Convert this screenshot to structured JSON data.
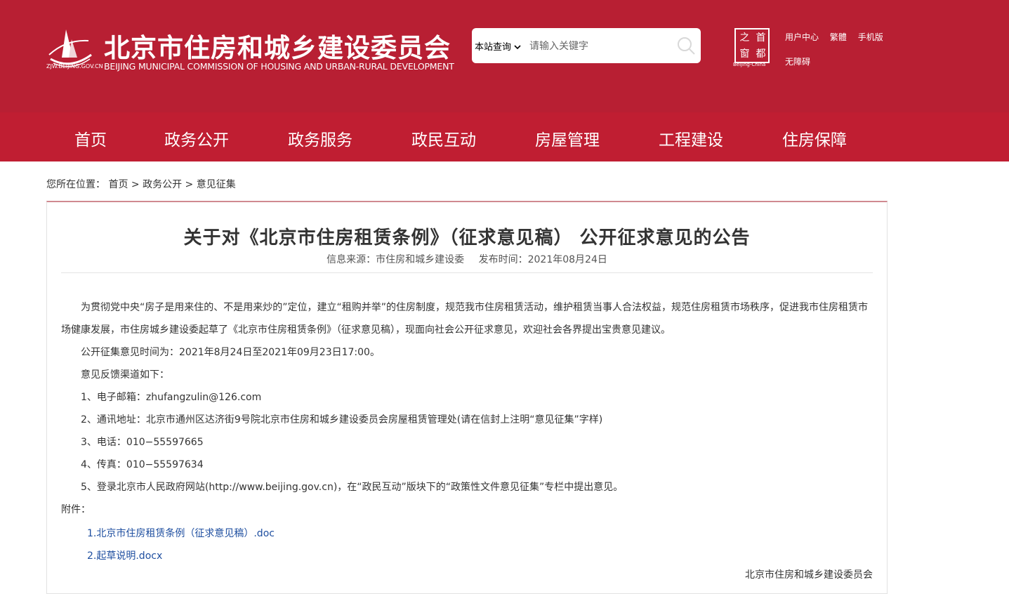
{
  "header": {
    "logo_domain": "ZJW.BEIJING.GOV.CN",
    "title": "北京市住房和城乡建设委员会",
    "subtitle": "BEIJING MUNICIPAL COMMISSION OF HOUSING AND URBAN-RURAL DEVELOPMENT",
    "colors": {
      "header_bg": "#b81f33",
      "nav_bg": "#c01e32"
    }
  },
  "search": {
    "scope_label": "本站查询",
    "placeholder": "请输入关键字",
    "button_icon": "search-icon"
  },
  "capital_logo": {
    "chars": [
      "之",
      "首",
      "窗",
      "都"
    ],
    "caption": "Beijing-China"
  },
  "top_links": {
    "user_center": "用户中心",
    "traditional": "繁體",
    "mobile": "手机版",
    "accessibility": "无障碍"
  },
  "nav": {
    "items": [
      "首页",
      "政务公开",
      "政务服务",
      "政民互动",
      "房屋管理",
      "工程建设",
      "住房保障"
    ]
  },
  "breadcrumb": {
    "prefix": "您所在位置：",
    "items": [
      "首页",
      "政务公开",
      "意见征集"
    ],
    "separator": ">"
  },
  "article": {
    "title": "关于对《北京市住房租赁条例》（征求意见稿） 公开征求意见的公告",
    "source": "信息来源：市住房和城乡建设委",
    "date": "发布时间：2021年08月24日",
    "paragraphs": [
      "为贯彻党中央“房子是用来住的、不是用来炒的”定位，建立“租购并举”的住房制度，规范我市住房租赁活动，维护租赁当事人合法权益，规范住房租赁市场秩序，促进我市住房租赁市",
      "场健康发展，市住房城乡建设委起草了《北京市住房租赁条例》（征求意见稿），现面向社会公开征求意见，欢迎社会各界提出宝贵意见建议。",
      "公开征集意见时间为：2021年8月24日至2021年09月23日17:00。",
      "意见反馈渠道如下：",
      "1、电子邮箱：zhufangzulin@126.com",
      "2、通讯地址：北京市通州区达济街9号院北京市住房和城乡建设委员会房屋租赁管理处(请在信封上注明“意见征集”字样)",
      "3、电话：010−55597665",
      "4、传真：010−55597634",
      "5、登录北京市人民政府网站(http://www.beijing.gov.cn)，在“政民互动”版块下的“政策性文件意见征集”专栏中提出意见。",
      "附件："
    ],
    "attachments": [
      "1.北京市住房租赁条例（征求意见稿）.doc",
      "2.起草说明.docx"
    ],
    "signature": "北京市住房和城乡建设委员会"
  }
}
